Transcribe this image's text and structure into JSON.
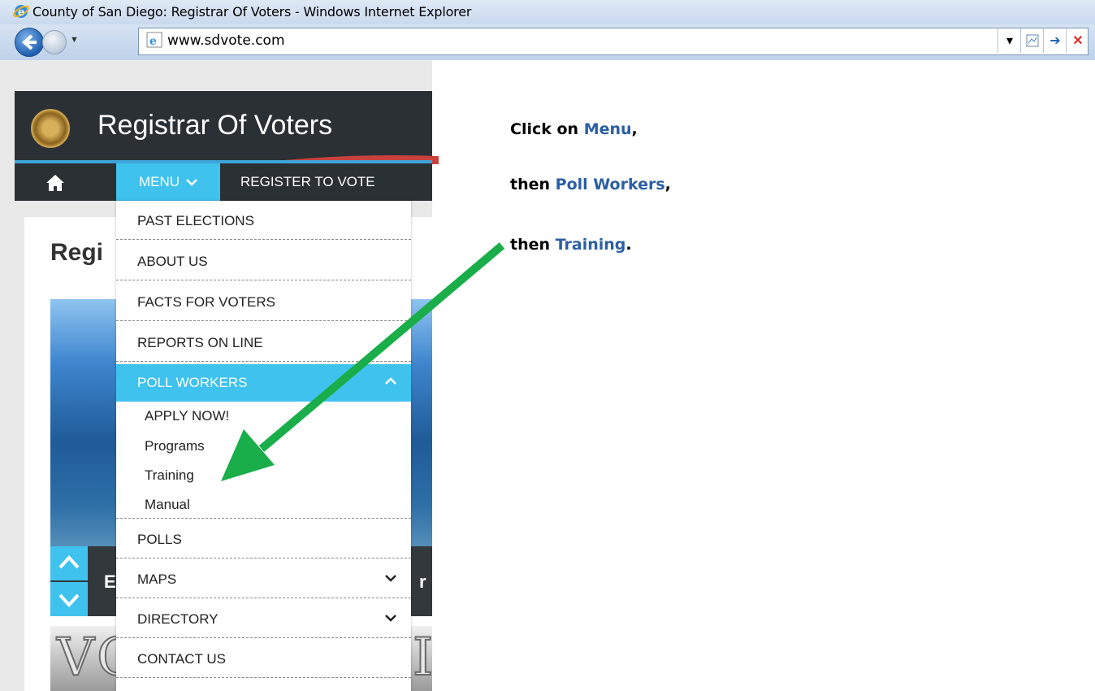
{
  "browser": {
    "title": "County of San Diego: Registrar Of Voters - Windows Internet Explorer",
    "url": "www.sdvote.com"
  },
  "site": {
    "brand": "Registrar Of Voters",
    "nav": {
      "menu": "MENU",
      "register": "REGISTER TO VOTE"
    },
    "page_title_partial": "Regi",
    "slider_left_letter": "E",
    "slider_right_letter": "r",
    "banner_text": "VO",
    "banner_tail": "I"
  },
  "dropdown": {
    "items": [
      {
        "label": "PAST ELECTIONS"
      },
      {
        "label": "ABOUT US"
      },
      {
        "label": "FACTS FOR VOTERS"
      },
      {
        "label": "REPORTS ON LINE"
      },
      {
        "label": "POLL WORKERS"
      },
      {
        "label": "POLLS"
      },
      {
        "label": "MAPS"
      },
      {
        "label": "DIRECTORY"
      },
      {
        "label": "CONTACT US"
      }
    ],
    "poll_sub": [
      "APPLY NOW!",
      "Programs",
      "Training",
      "Manual"
    ]
  },
  "instructions": {
    "line1_prefix": "Click on ",
    "line1_highlight": "Menu",
    "line1_suffix": ",",
    "line2_prefix": "then ",
    "line2_highlight": "Poll Workers",
    "line2_suffix": ",",
    "line3_prefix": "then ",
    "line3_highlight": "Training",
    "line3_suffix": "."
  },
  "colors": {
    "accent": "#3fc2ee",
    "header_dark": "#2b3035",
    "instruction_highlight": "#2a5fa3",
    "pointer_arrow": "#1aae4a"
  }
}
